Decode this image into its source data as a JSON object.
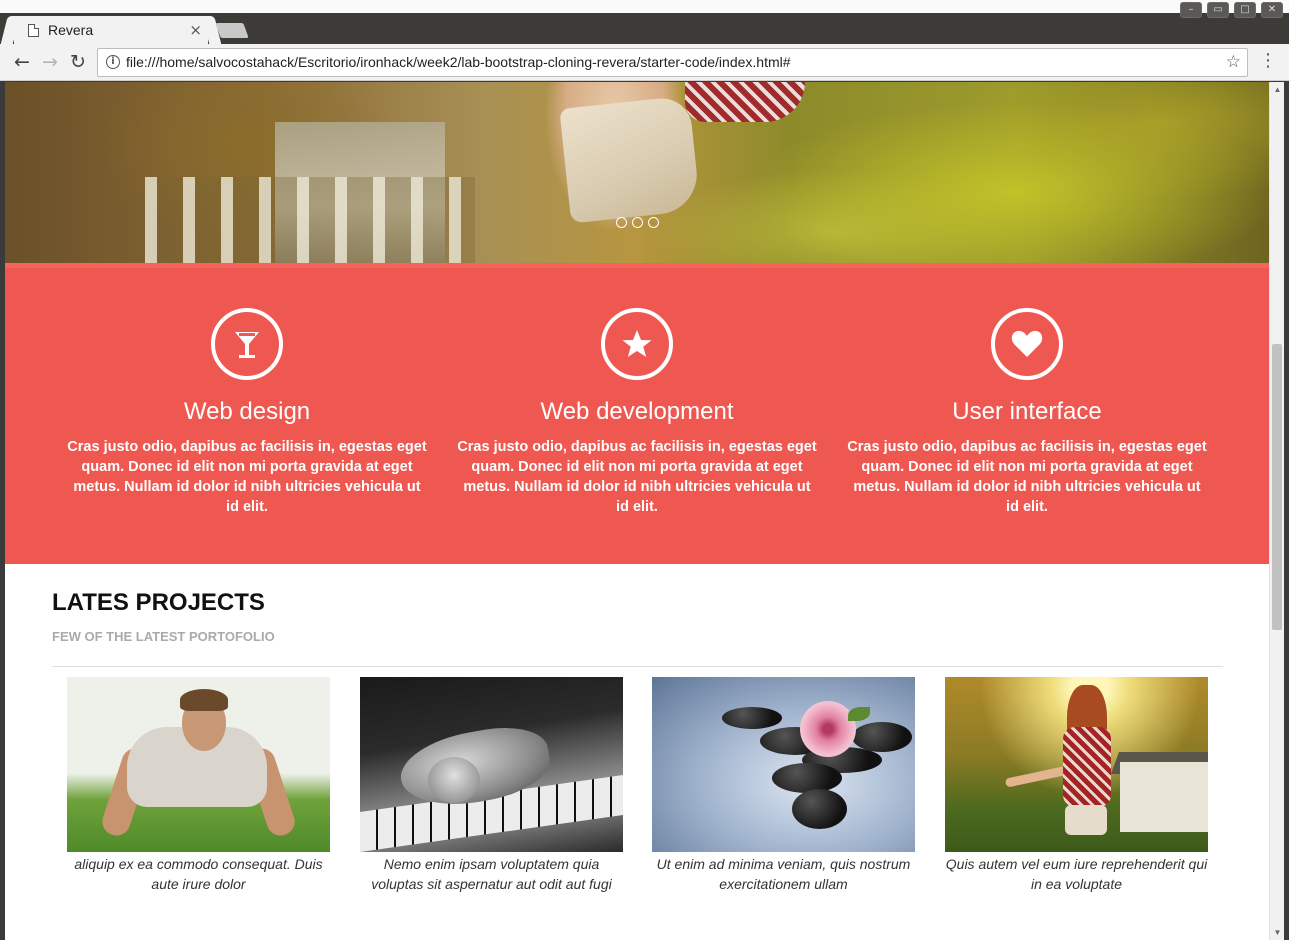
{
  "browser": {
    "tab_title": "Revera",
    "tab_close": "×",
    "url": "file:///home/salvocostahack/Escritorio/ironhack/week2/lab-bootstrap-cloning-revera/starter-code/index.html#",
    "icons": [
      "back-arrow-icon",
      "forward-arrow-icon",
      "reload-icon",
      "info-icon",
      "star-icon",
      "menu-icon"
    ]
  },
  "hero": {
    "slide_count": 3
  },
  "colors": {
    "services_bg": "#ef5850",
    "services_border": "#f5645a"
  },
  "services": [
    {
      "icon": "cocktail-glass-icon",
      "title": "Web design",
      "text": "Cras justo odio, dapibus ac facilisis in, egestas eget quam. Donec id elit non mi porta gravida at eget metus. Nullam id dolor id nibh ultricies vehicula ut id elit."
    },
    {
      "icon": "star-icon",
      "title": "Web development",
      "text": "Cras justo odio, dapibus ac facilisis in, egestas eget quam. Donec id elit non mi porta gravida at eget metus. Nullam id dolor id nibh ultricies vehicula ut id elit."
    },
    {
      "icon": "heart-icon",
      "title": "User interface",
      "text": "Cras justo odio, dapibus ac facilisis in, egestas eget quam. Donec id elit non mi porta gravida at eget metus. Nullam id dolor id nibh ultricies vehicula ut id elit."
    }
  ],
  "projects": {
    "title": "LATES PROJECTS",
    "subtitle": "FEW OF THE LATEST PORTOFOLIO",
    "items": [
      {
        "image": "man-doing-pushups",
        "caption": "aliquip ex ea commodo consequat. Duis aute irure dolor"
      },
      {
        "image": "kitten-on-piano",
        "caption": "Nemo enim ipsam voluptatem quia voluptas sit aspernatur aut odit aut fugi"
      },
      {
        "image": "rose-on-black-stones",
        "caption": "Ut enim ad minima veniam, quis nostrum exercitationem ullam"
      },
      {
        "image": "girl-in-sunlight",
        "caption": "Quis autem vel eum iure reprehenderit qui in ea voluptate"
      }
    ]
  }
}
